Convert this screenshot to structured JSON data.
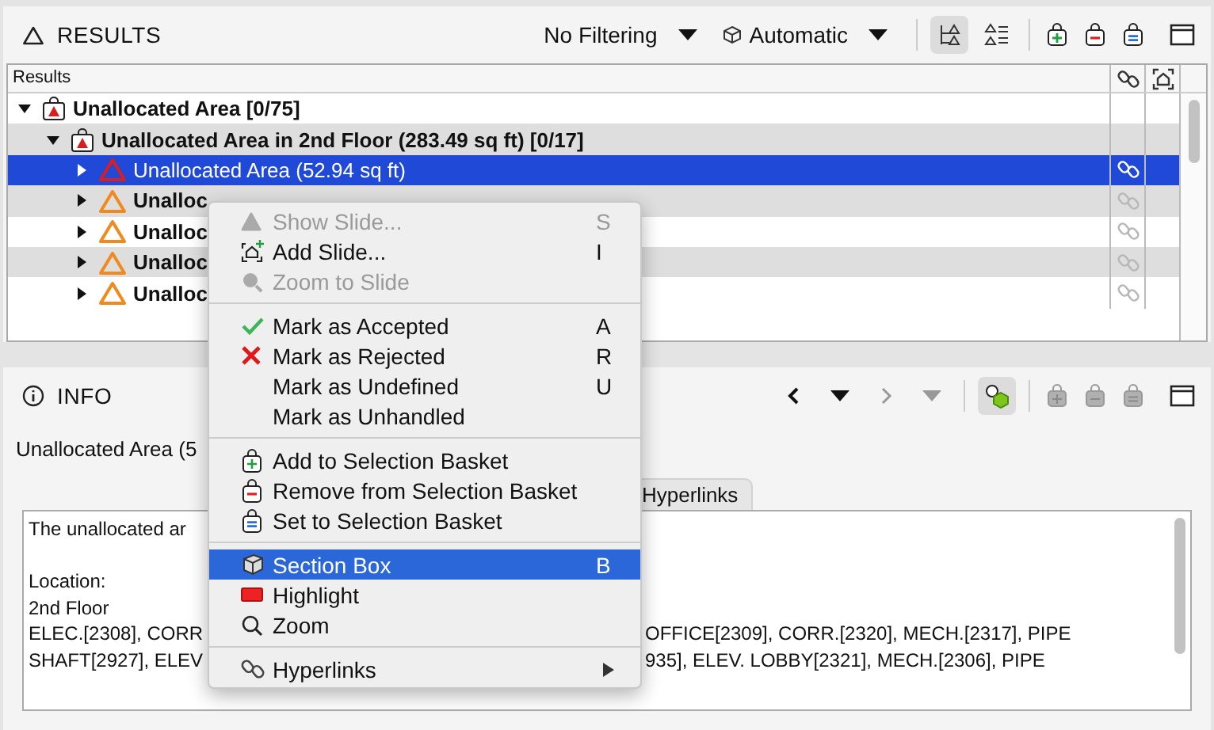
{
  "results_panel": {
    "title": "RESULTS",
    "filter": "No Filtering",
    "mode": "Automatic",
    "view_toggles": [
      {
        "selected": true
      },
      {
        "selected": false
      }
    ],
    "table": {
      "column_1": "Results",
      "rows": [
        {
          "kind": "group",
          "label": "Unallocated Area [0/75]",
          "expanded": true,
          "children": [
            {
              "kind": "group",
              "label": "Unallocated Area in 2nd Floor (283.49 sq ft) [0/17]",
              "expanded": true,
              "children": [
                {
                  "kind": "item",
                  "label": "Unallocated Area (52.94 sq ft)",
                  "color": "#d81e1e",
                  "selected": true
                },
                {
                  "kind": "item",
                  "label": "Unalloc",
                  "color": "#f08a1c",
                  "selected": false
                },
                {
                  "kind": "item",
                  "label": "Unalloc",
                  "color": "#f08a1c",
                  "selected": false
                },
                {
                  "kind": "item",
                  "label": "Unalloc",
                  "color": "#f08a1c",
                  "selected": false
                },
                {
                  "kind": "item",
                  "label": "Unalloc",
                  "color": "#f08a1c",
                  "selected": false
                }
              ]
            }
          ]
        }
      ]
    }
  },
  "info_panel": {
    "title": "INFO",
    "back_disabled": false,
    "forward_disabled": true,
    "section_box_selected": true,
    "basket_disabled": true,
    "subtitle": "Unallocated Area (5",
    "tabs": [
      {
        "label": "Hyperlinks",
        "selected": false
      }
    ],
    "description_lines": [
      {
        "kind": "text",
        "text": "The unallocated ar"
      },
      {
        "kind": "blank"
      },
      {
        "kind": "text",
        "text": "Location:"
      },
      {
        "kind": "text",
        "text": "2nd Floor"
      },
      {
        "kind": "text",
        "text": "ELEC.[2308], CORR",
        "text_after_menu": "OFFICE[2309], CORR.[2320], MECH.[2317], PIPE"
      },
      {
        "kind": "text",
        "text": "SHAFT[2927], ELEV",
        "text_after_menu": "935], ELEV. LOBBY[2321], MECH.[2306], PIPE"
      }
    ]
  },
  "context_menu": {
    "groups": [
      [
        {
          "label": "Show Slide...",
          "shortcut": "S",
          "disabled": true,
          "selected": false
        },
        {
          "label": "Add Slide...",
          "shortcut": "I",
          "disabled": false,
          "selected": false
        },
        {
          "label": "Zoom to Slide",
          "disabled": true,
          "selected": false
        }
      ],
      [
        {
          "label": "Mark as Accepted",
          "shortcut": "A",
          "disabled": false,
          "selected": false
        },
        {
          "label": "Mark as Rejected",
          "shortcut": "R",
          "disabled": false,
          "selected": false
        },
        {
          "label": "Mark as Undefined",
          "shortcut": "U",
          "disabled": false,
          "selected": false
        },
        {
          "label": "Mark as Unhandled",
          "disabled": false,
          "selected": false
        }
      ],
      [
        {
          "label": "Add to Selection Basket",
          "disabled": false,
          "selected": false
        },
        {
          "label": "Remove from Selection Basket",
          "disabled": false,
          "selected": false
        },
        {
          "label": "Set to Selection Basket",
          "disabled": false,
          "selected": false
        }
      ],
      [
        {
          "label": "Section Box",
          "shortcut": "B",
          "disabled": false,
          "selected": true
        },
        {
          "label": "Highlight",
          "disabled": false,
          "selected": false
        },
        {
          "label": "Zoom",
          "disabled": false,
          "selected": false
        }
      ],
      [
        {
          "label": "Hyperlinks",
          "disabled": false,
          "selected": false,
          "submenu": true
        }
      ]
    ]
  }
}
